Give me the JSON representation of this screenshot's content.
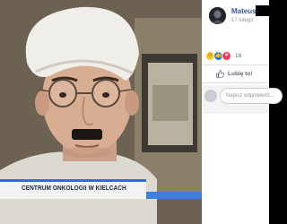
{
  "photo": {
    "caption": "CENTRUM ONKOLOGII W KIELCACH",
    "accent_color": "#2f6fd4"
  },
  "comment_panel": {
    "author": "Mateusz",
    "date": "17 lutego",
    "reactions": {
      "icons": [
        "haha-icon",
        "like-icon",
        "love-icon"
      ],
      "count": "16"
    },
    "like_label": "Lubię to!",
    "comment_placeholder": "Napisz odpowiedź..."
  },
  "colors": {
    "link_blue": "#385898",
    "muted_gray": "#90949c",
    "panel_bg": "#ffffff"
  }
}
